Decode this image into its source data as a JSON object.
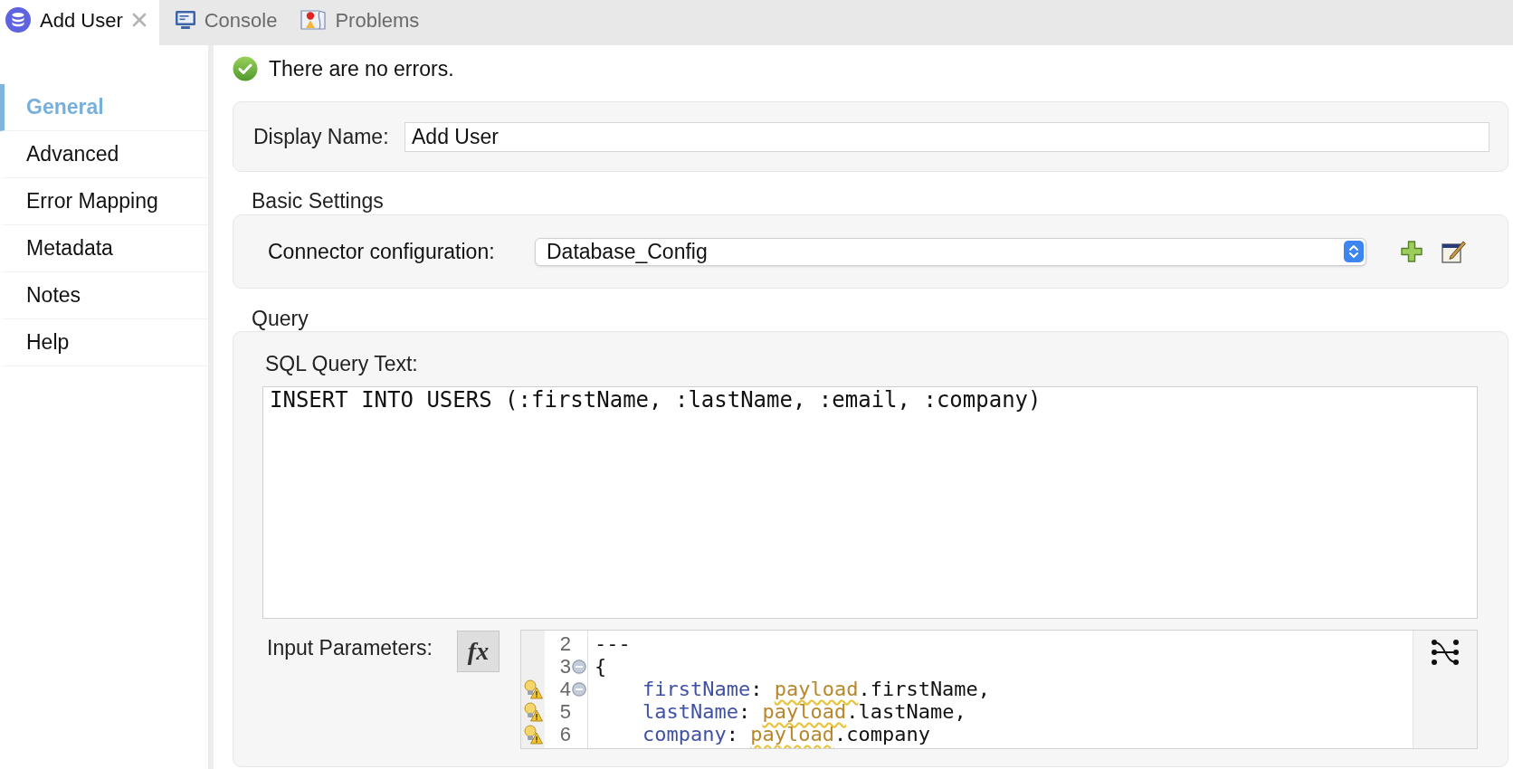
{
  "tabs": [
    {
      "label": "Add User",
      "selected": true
    },
    {
      "label": "Console",
      "selected": false
    },
    {
      "label": "Problems",
      "selected": false
    }
  ],
  "sidebar": {
    "items": [
      {
        "label": "General",
        "selected": true
      },
      {
        "label": "Advanced",
        "selected": false
      },
      {
        "label": "Error Mapping",
        "selected": false
      },
      {
        "label": "Metadata",
        "selected": false
      },
      {
        "label": "Notes",
        "selected": false
      },
      {
        "label": "Help",
        "selected": false
      }
    ]
  },
  "validation": {
    "message": "There are no errors."
  },
  "display_name": {
    "label": "Display Name:",
    "value": "Add User"
  },
  "basic_settings": {
    "heading": "Basic Settings",
    "connector_configuration": {
      "label": "Connector configuration:",
      "value": "Database_Config"
    }
  },
  "query": {
    "heading": "Query",
    "sql_query_text": {
      "label": "SQL Query Text:",
      "value": "INSERT INTO USERS (:firstName, :lastName, :email, :company)"
    },
    "input_parameters": {
      "label": "Input Parameters:",
      "expression_button": "fx",
      "lines": [
        {
          "number": "2",
          "warning": false,
          "foldable": false,
          "tokens": [
            {
              "kind": "plain",
              "text": "---"
            }
          ]
        },
        {
          "number": "3",
          "warning": false,
          "foldable": true,
          "tokens": [
            {
              "kind": "plain",
              "text": "{"
            }
          ]
        },
        {
          "number": "4",
          "warning": true,
          "foldable": true,
          "tokens": [
            {
              "kind": "key",
              "text": "    firstName"
            },
            {
              "kind": "plain",
              "text": ": "
            },
            {
              "kind": "flagged",
              "text": "payload"
            },
            {
              "kind": "plain",
              "text": ".firstName,"
            }
          ]
        },
        {
          "number": "5",
          "warning": true,
          "foldable": false,
          "tokens": [
            {
              "kind": "key",
              "text": "    lastName"
            },
            {
              "kind": "plain",
              "text": ": "
            },
            {
              "kind": "flagged",
              "text": "payload"
            },
            {
              "kind": "plain",
              "text": ".lastName,"
            }
          ]
        },
        {
          "number": "6",
          "warning": true,
          "foldable": false,
          "tokens": [
            {
              "kind": "key",
              "text": "    company"
            },
            {
              "kind": "plain",
              "text": ": "
            },
            {
              "kind": "flagged",
              "text": "payload"
            },
            {
              "kind": "plain",
              "text": ".company"
            }
          ]
        }
      ]
    }
  }
}
